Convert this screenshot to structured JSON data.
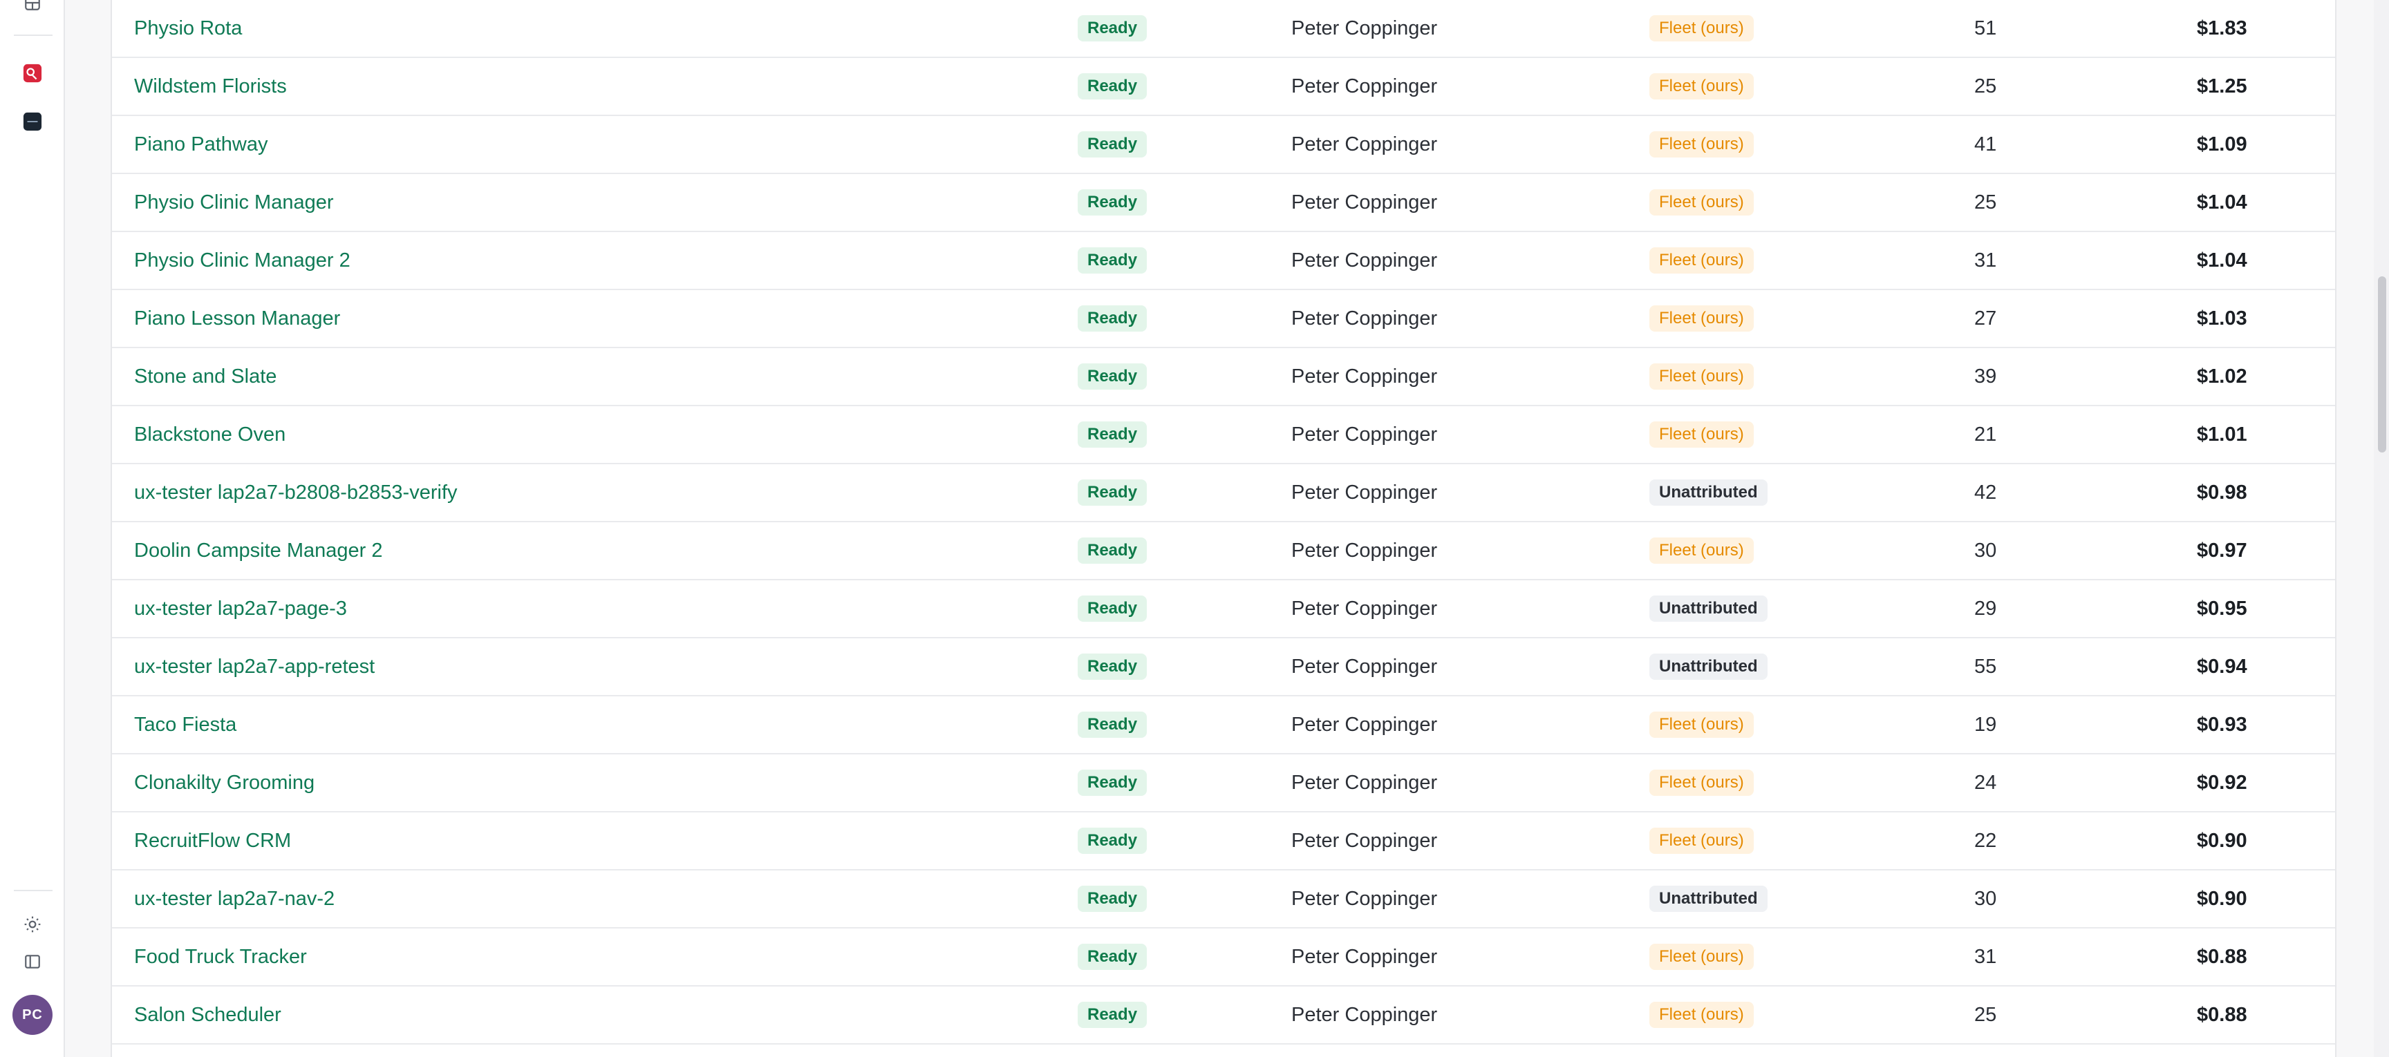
{
  "rail": {
    "icons": {
      "top": "layout-icon",
      "app_red": "app-icon",
      "app_dark": "app-icon",
      "theme": "sun-icon",
      "panel": "sidebar-toggle-icon"
    },
    "avatar_initials": "PC"
  },
  "colors": {
    "link_green": "#0f7a55",
    "ready_bg": "#e3f5ea",
    "fleet_bg": "#fff2df",
    "fleet_text": "#e58a00",
    "avatar": "#6b4c8c",
    "app_red": "#d9263c"
  },
  "rows": [
    {
      "name": "Physio Rota",
      "status": "Ready",
      "owner": "Peter Coppinger",
      "source": "Fleet (ours)",
      "count": "51",
      "cost": "$1.83"
    },
    {
      "name": "Wildstem Florists",
      "status": "Ready",
      "owner": "Peter Coppinger",
      "source": "Fleet (ours)",
      "count": "25",
      "cost": "$1.25"
    },
    {
      "name": "Piano Pathway",
      "status": "Ready",
      "owner": "Peter Coppinger",
      "source": "Fleet (ours)",
      "count": "41",
      "cost": "$1.09"
    },
    {
      "name": "Physio Clinic Manager",
      "status": "Ready",
      "owner": "Peter Coppinger",
      "source": "Fleet (ours)",
      "count": "25",
      "cost": "$1.04"
    },
    {
      "name": "Physio Clinic Manager 2",
      "status": "Ready",
      "owner": "Peter Coppinger",
      "source": "Fleet (ours)",
      "count": "31",
      "cost": "$1.04"
    },
    {
      "name": "Piano Lesson Manager",
      "status": "Ready",
      "owner": "Peter Coppinger",
      "source": "Fleet (ours)",
      "count": "27",
      "cost": "$1.03"
    },
    {
      "name": "Stone and Slate",
      "status": "Ready",
      "owner": "Peter Coppinger",
      "source": "Fleet (ours)",
      "count": "39",
      "cost": "$1.02"
    },
    {
      "name": "Blackstone Oven",
      "status": "Ready",
      "owner": "Peter Coppinger",
      "source": "Fleet (ours)",
      "count": "21",
      "cost": "$1.01"
    },
    {
      "name": "ux-tester lap2a7-b2808-b2853-verify",
      "status": "Ready",
      "owner": "Peter Coppinger",
      "source": "Unattributed",
      "count": "42",
      "cost": "$0.98"
    },
    {
      "name": "Doolin Campsite Manager 2",
      "status": "Ready",
      "owner": "Peter Coppinger",
      "source": "Fleet (ours)",
      "count": "30",
      "cost": "$0.97"
    },
    {
      "name": "ux-tester lap2a7-page-3",
      "status": "Ready",
      "owner": "Peter Coppinger",
      "source": "Unattributed",
      "count": "29",
      "cost": "$0.95"
    },
    {
      "name": "ux-tester lap2a7-app-retest",
      "status": "Ready",
      "owner": "Peter Coppinger",
      "source": "Unattributed",
      "count": "55",
      "cost": "$0.94"
    },
    {
      "name": "Taco Fiesta",
      "status": "Ready",
      "owner": "Peter Coppinger",
      "source": "Fleet (ours)",
      "count": "19",
      "cost": "$0.93"
    },
    {
      "name": "Clonakilty Grooming",
      "status": "Ready",
      "owner": "Peter Coppinger",
      "source": "Fleet (ours)",
      "count": "24",
      "cost": "$0.92"
    },
    {
      "name": "RecruitFlow CRM",
      "status": "Ready",
      "owner": "Peter Coppinger",
      "source": "Fleet (ours)",
      "count": "22",
      "cost": "$0.90"
    },
    {
      "name": "ux-tester lap2a7-nav-2",
      "status": "Ready",
      "owner": "Peter Coppinger",
      "source": "Unattributed",
      "count": "30",
      "cost": "$0.90"
    },
    {
      "name": "Food Truck Tracker",
      "status": "Ready",
      "owner": "Peter Coppinger",
      "source": "Fleet (ours)",
      "count": "31",
      "cost": "$0.88"
    },
    {
      "name": "Salon Scheduler",
      "status": "Ready",
      "owner": "Peter Coppinger",
      "source": "Fleet (ours)",
      "count": "25",
      "cost": "$0.88"
    }
  ]
}
